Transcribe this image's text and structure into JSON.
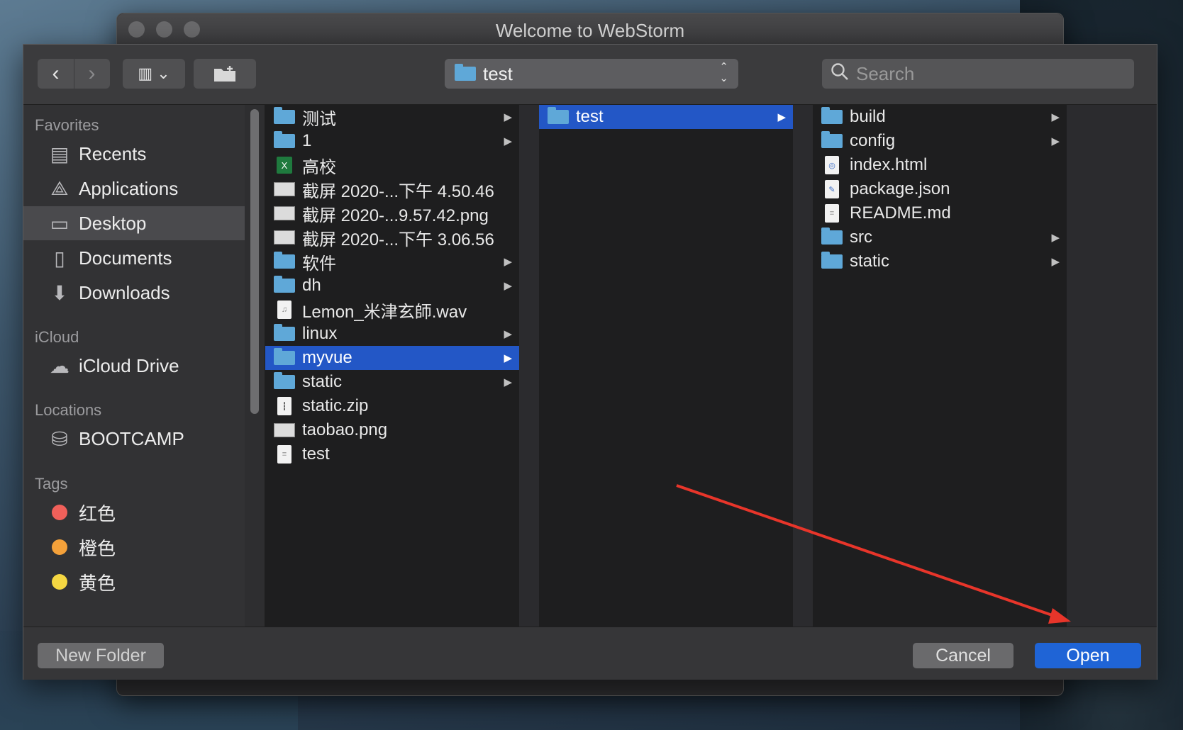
{
  "window_title": "Welcome to WebStorm",
  "toolbar": {
    "back_icon": "‹",
    "forward_icon": "›",
    "view_icon": "▥ ⌄",
    "new_folder_icon": "📁",
    "path_label": "test",
    "updown_icon": "⌃⌄",
    "search_placeholder": "Search"
  },
  "sidebar": {
    "favorites_header": "Favorites",
    "favorites": [
      {
        "label": "Recents",
        "icon": "recents-icon"
      },
      {
        "label": "Applications",
        "icon": "applications-icon"
      },
      {
        "label": "Desktop",
        "icon": "desktop-icon",
        "selected": true
      },
      {
        "label": "Documents",
        "icon": "documents-icon"
      },
      {
        "label": "Downloads",
        "icon": "downloads-icon"
      }
    ],
    "icloud_header": "iCloud",
    "icloud": [
      {
        "label": "iCloud Drive",
        "icon": "cloud-icon"
      }
    ],
    "locations_header": "Locations",
    "locations": [
      {
        "label": "BOOTCAMP",
        "icon": "disk-icon"
      }
    ],
    "tags_header": "Tags",
    "tags": [
      {
        "label": "红色",
        "color": "#f0605a"
      },
      {
        "label": "橙色",
        "color": "#f4a13a"
      },
      {
        "label": "黄色",
        "color": "#f5d742"
      }
    ]
  },
  "column1": [
    {
      "name": "测试",
      "kind": "folder",
      "arrow": true
    },
    {
      "name": "1",
      "kind": "folder",
      "arrow": true
    },
    {
      "name": "高校",
      "kind": "xls"
    },
    {
      "name": "截屏 2020-...下午 4.50.46",
      "kind": "image"
    },
    {
      "name": "截屏 2020-...9.57.42.png",
      "kind": "image"
    },
    {
      "name": "截屏 2020-...下午 3.06.56",
      "kind": "image"
    },
    {
      "name": "软件",
      "kind": "folder",
      "arrow": true
    },
    {
      "name": "dh",
      "kind": "folder",
      "arrow": true
    },
    {
      "name": "Lemon_米津玄師.wav",
      "kind": "audio"
    },
    {
      "name": "linux",
      "kind": "folder",
      "arrow": true
    },
    {
      "name": "myvue",
      "kind": "folder",
      "arrow": true,
      "selected": true
    },
    {
      "name": "static",
      "kind": "folder",
      "arrow": true
    },
    {
      "name": "static.zip",
      "kind": "zip"
    },
    {
      "name": "taobao.png",
      "kind": "image"
    },
    {
      "name": "test",
      "kind": "doc"
    }
  ],
  "column2": [
    {
      "name": "test",
      "kind": "folder",
      "arrow": true,
      "selected": true
    }
  ],
  "column3": [
    {
      "name": "build",
      "kind": "folder",
      "arrow": true
    },
    {
      "name": "config",
      "kind": "folder",
      "arrow": true
    },
    {
      "name": "index.html",
      "kind": "html"
    },
    {
      "name": "package.json",
      "kind": "json"
    },
    {
      "name": "README.md",
      "kind": "doc"
    },
    {
      "name": "src",
      "kind": "folder",
      "arrow": true
    },
    {
      "name": "static",
      "kind": "folder",
      "arrow": true
    }
  ],
  "footer": {
    "new_folder": "New Folder",
    "cancel": "Cancel",
    "open": "Open"
  },
  "colors": {
    "selection": "#2357c6",
    "open_button": "#1f64d6",
    "annotation_arrow": "#e8352a"
  }
}
